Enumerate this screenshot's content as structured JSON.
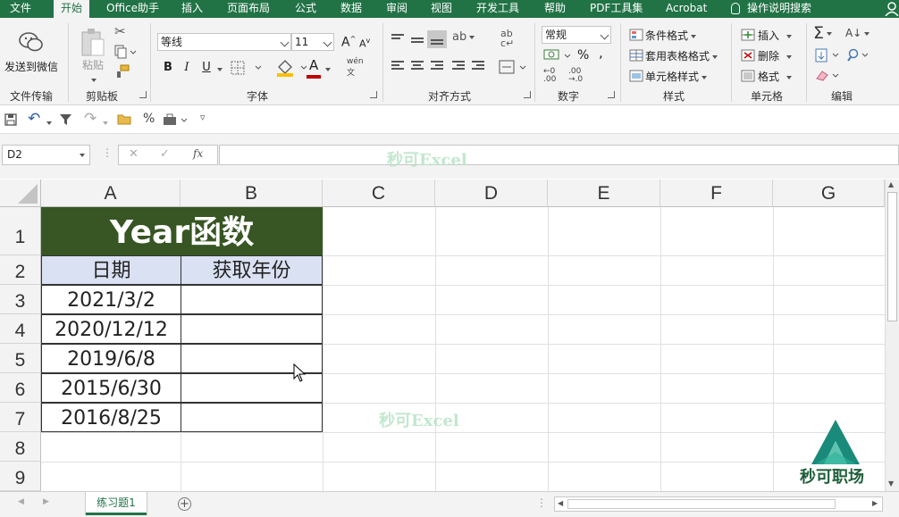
{
  "ribbon_tabs": [
    "文件",
    "开始",
    "Office助手",
    "插入",
    "页面布局",
    "公式",
    "数据",
    "审阅",
    "视图",
    "开发工具",
    "帮助",
    "PDF工具集",
    "Acrobat"
  ],
  "active_tab": "开始",
  "tell_me": "操作说明搜索",
  "groups": {
    "file_transfer": {
      "button": "发送到微信",
      "label": "文件传输"
    },
    "clipboard": {
      "paste": "粘贴",
      "label": "剪贴板"
    },
    "font": {
      "name": "等线",
      "size": "11",
      "bold": "B",
      "italic": "I",
      "underline": "U",
      "grow": "A",
      "shrink": "A",
      "color_a": "A",
      "label": "字体"
    },
    "alignment": {
      "label": "对齐方式"
    },
    "number": {
      "format": "常规",
      "percent": "%",
      "label": "数字"
    },
    "styles": {
      "conditional": "条件格式",
      "table": "套用表格格式",
      "cell": "单元格样式",
      "label": "样式"
    },
    "cells": {
      "insert": "插入",
      "delete": "删除",
      "format": "格式",
      "label": "单元格"
    },
    "editing": {
      "label": "编辑"
    }
  },
  "qat": {
    "percent": "%"
  },
  "name_box": "D2",
  "formula_icons": {
    "cancel": "✕",
    "enter": "✓",
    "fx": "fx"
  },
  "columns": [
    "A",
    "B",
    "C",
    "D",
    "E",
    "F",
    "G"
  ],
  "rows": [
    "1",
    "2",
    "3",
    "4",
    "5",
    "6",
    "7",
    "8",
    "9"
  ],
  "sheet": {
    "title": "Year函数",
    "header_a": "日期",
    "header_b": "获取年份",
    "dates": [
      "2021/3/2",
      "2020/12/12",
      "2019/6/8",
      "2015/6/30",
      "2016/8/25"
    ]
  },
  "watermark": "秒可Excel",
  "logo_text": "秒可职场",
  "sheet_tab": "练习题1",
  "colors": {
    "excel_green": "#217346",
    "title_fill": "#375623",
    "header_fill": "#d9e1f2"
  }
}
